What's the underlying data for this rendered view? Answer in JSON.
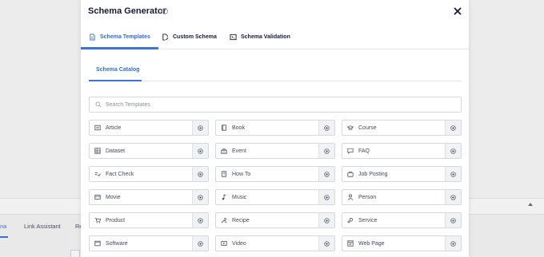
{
  "background": {
    "tabs": [
      {
        "label": "na",
        "active": true
      },
      {
        "label": "Link Assistant",
        "active": false
      },
      {
        "label": "Re",
        "active": false
      }
    ]
  },
  "modal": {
    "title": "Schema Generator",
    "help_icon": "?",
    "tabs": [
      {
        "label": "Schema Templates",
        "icon": "document-icon",
        "active": true
      },
      {
        "label": "Custom Schema",
        "icon": "document-edit-icon",
        "active": false
      },
      {
        "label": "Schema Validation",
        "icon": "terminal-icon",
        "active": false
      }
    ],
    "catalog_tab": "Schema Catalog",
    "search": {
      "placeholder": "Search Templates",
      "value": ""
    },
    "templates": [
      {
        "label": "Article",
        "icon": "article-icon"
      },
      {
        "label": "Book",
        "icon": "book-icon"
      },
      {
        "label": "Course",
        "icon": "course-icon"
      },
      {
        "label": "Dataset",
        "icon": "dataset-icon"
      },
      {
        "label": "Event",
        "icon": "event-icon"
      },
      {
        "label": "FAQ",
        "icon": "faq-icon"
      },
      {
        "label": "Fact Check",
        "icon": "fact-check-icon"
      },
      {
        "label": "How To",
        "icon": "how-to-icon"
      },
      {
        "label": "Job Posting",
        "icon": "job-posting-icon"
      },
      {
        "label": "Movie",
        "icon": "movie-icon"
      },
      {
        "label": "Music",
        "icon": "music-icon"
      },
      {
        "label": "Person",
        "icon": "person-icon"
      },
      {
        "label": "Product",
        "icon": "product-icon"
      },
      {
        "label": "Recipe",
        "icon": "recipe-icon"
      },
      {
        "label": "Service",
        "icon": "service-icon"
      },
      {
        "label": "Software",
        "icon": "software-icon"
      },
      {
        "label": "Video",
        "icon": "video-icon"
      },
      {
        "label": "Web Page",
        "icon": "web-page-icon"
      }
    ]
  },
  "colors": {
    "accent": "#2d6dd2",
    "text": "#141b38",
    "muted_text": "#434960",
    "border": "#d6d7de"
  }
}
